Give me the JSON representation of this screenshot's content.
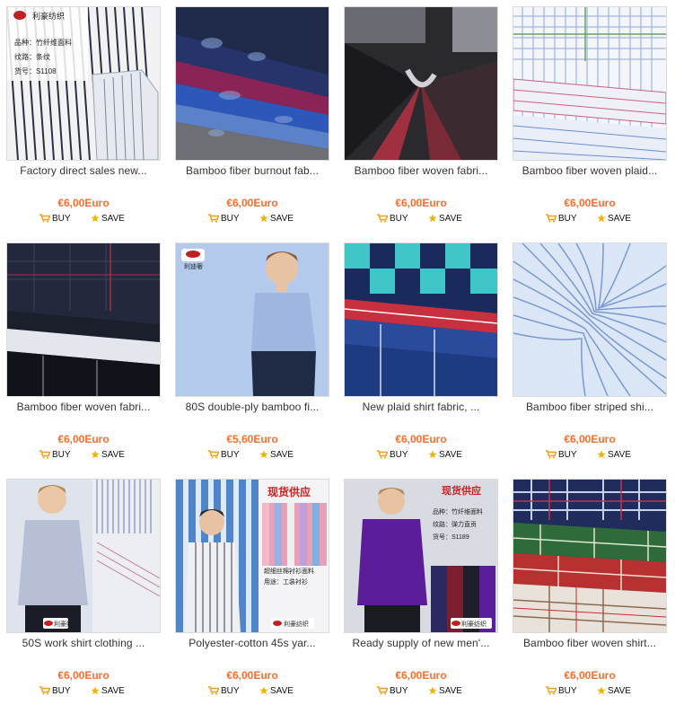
{
  "products": [
    {
      "title": "Factory direct sales new...",
      "price": "€6,00Euro",
      "buy": "BUY",
      "save": "SAVE",
      "overlay": [
        "利豪纺织",
        "品种：竹纤维面料",
        "纹路：条纹",
        "货号：S1108"
      ]
    },
    {
      "title": "Bamboo fiber burnout fab...",
      "price": "€6,00Euro",
      "buy": "BUY",
      "save": "SAVE",
      "overlay": []
    },
    {
      "title": "Bamboo fiber woven fabri...",
      "price": "€6,00Euro",
      "buy": "BUY",
      "save": "SAVE",
      "overlay": []
    },
    {
      "title": "Bamboo fiber woven plaid...",
      "price": "€6,00Euro",
      "buy": "BUY",
      "save": "SAVE",
      "overlay": []
    },
    {
      "title": "Bamboo fiber woven fabri...",
      "price": "€6,00Euro",
      "buy": "BUY",
      "save": "SAVE",
      "overlay": []
    },
    {
      "title": "80S double-ply bamboo fi...",
      "price": "€5,60Euro",
      "buy": "BUY",
      "save": "SAVE",
      "overlay": [
        "利迪奢"
      ]
    },
    {
      "title": "New plaid shirt fabric, ...",
      "price": "€6,00Euro",
      "buy": "BUY",
      "save": "SAVE",
      "overlay": []
    },
    {
      "title": "Bamboo fiber striped shi...",
      "price": "€6,00Euro",
      "buy": "BUY",
      "save": "SAVE",
      "overlay": []
    },
    {
      "title": "50S work shirt clothing ...",
      "price": "€6,00Euro",
      "buy": "BUY",
      "save": "SAVE",
      "overlay": [
        "利豪纺织"
      ]
    },
    {
      "title": "Polyester-cotton 45s yar...",
      "price": "€6,00Euro",
      "buy": "BUY",
      "save": "SAVE",
      "overlay": [
        "现货供应",
        "超细丝棉衬衫面料",
        "用途：工装衬衫",
        "利豪纺织"
      ]
    },
    {
      "title": "Ready supply of new men'...",
      "price": "€6,00Euro",
      "buy": "BUY",
      "save": "SAVE",
      "overlay": [
        "现货供应",
        "品种：竹纤维面料",
        "纹路：弹力直贡",
        "货号：S1189",
        "利豪纺织"
      ]
    },
    {
      "title": "Bamboo fiber woven shirt...",
      "price": "€6,00Euro",
      "buy": "BUY",
      "save": "SAVE",
      "overlay": []
    }
  ],
  "colors": {
    "price": "#ff6d2d",
    "cart_icon": "#f0a020",
    "star_icon": "#f0b400",
    "title": "#333333"
  },
  "icons": {
    "buy": "shopping-cart-icon",
    "save": "star-icon"
  }
}
